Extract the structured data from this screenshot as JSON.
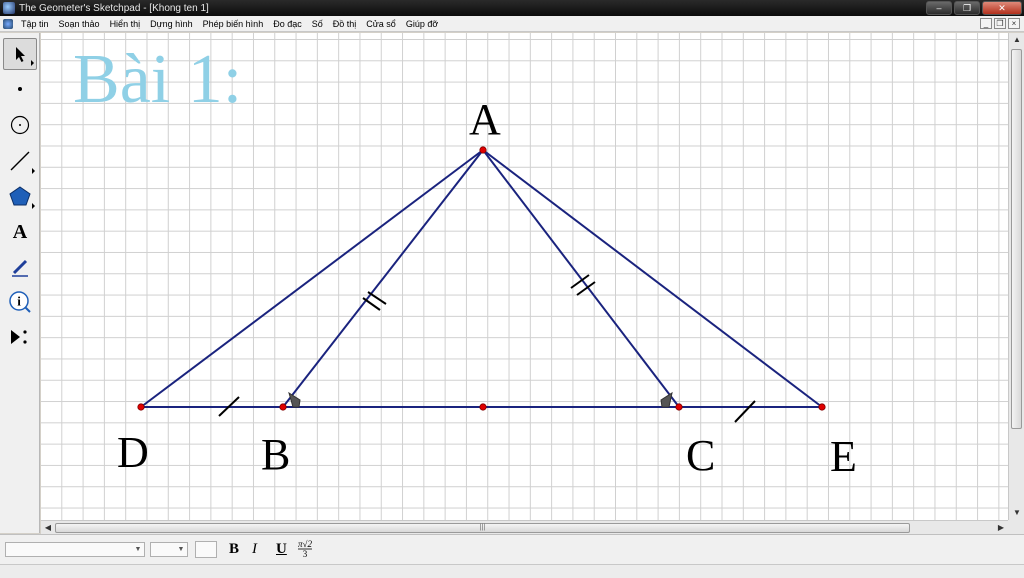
{
  "window": {
    "title": "The Geometer's Sketchpad - [Khong ten 1]"
  },
  "menu": {
    "items": [
      "Tập tin",
      "Soạn thảo",
      "Hiển thị",
      "Dựng hình",
      "Phép biến hình",
      "Đo đạc",
      "Số",
      "Đồ thị",
      "Cửa sổ",
      "Giúp đỡ"
    ]
  },
  "toolbox": {
    "tools": [
      "arrow-tool",
      "point-tool",
      "compass-tool",
      "straightedge-tool",
      "polygon-tool",
      "text-tool",
      "marker-tool",
      "information-tool",
      "custom-tool"
    ]
  },
  "canvas": {
    "title": "Bài 1:",
    "points": {
      "A": {
        "label": "A"
      },
      "B": {
        "label": "B"
      },
      "C": {
        "label": "C"
      },
      "D": {
        "label": "D"
      },
      "E": {
        "label": "E"
      }
    }
  },
  "textbar": {
    "bold": "B",
    "italic": "I",
    "underline": "U"
  },
  "colors": {
    "segment": "#1a237e",
    "point": "#e00000",
    "title": "#8fd0e6"
  }
}
